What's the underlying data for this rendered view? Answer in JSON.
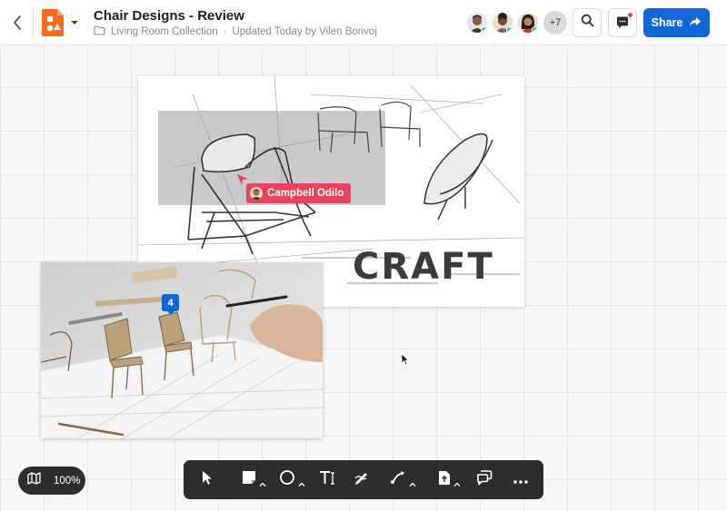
{
  "header": {
    "title": "Chair Designs - Review",
    "folder": "Living Room Collection",
    "separator": "·",
    "updated": "Updated Today by Vilen Borivoj",
    "more_collaborators": "+7",
    "share_label": "Share"
  },
  "canvas": {
    "sketch_word": "CRAFT",
    "cursor_user": "Campbell Odilo",
    "comment_count": "4"
  },
  "zoom": {
    "level": "100%"
  },
  "colors": {
    "accent": "#1366d6",
    "logo": "#f26b21",
    "cursor_label": "#e8435a",
    "toolbar": "#2d2d2d",
    "online": "#2ecc71"
  },
  "icons": [
    "back-chevron-icon",
    "app-logo-icon",
    "folder-icon",
    "search-icon",
    "chat-icon",
    "share-arrow-icon",
    "map-icon",
    "pointer-icon",
    "sticky-note-icon",
    "shape-circle-icon",
    "text-icon",
    "pen-icon",
    "connector-icon",
    "upload-icon",
    "comment-icon",
    "more-icon"
  ]
}
